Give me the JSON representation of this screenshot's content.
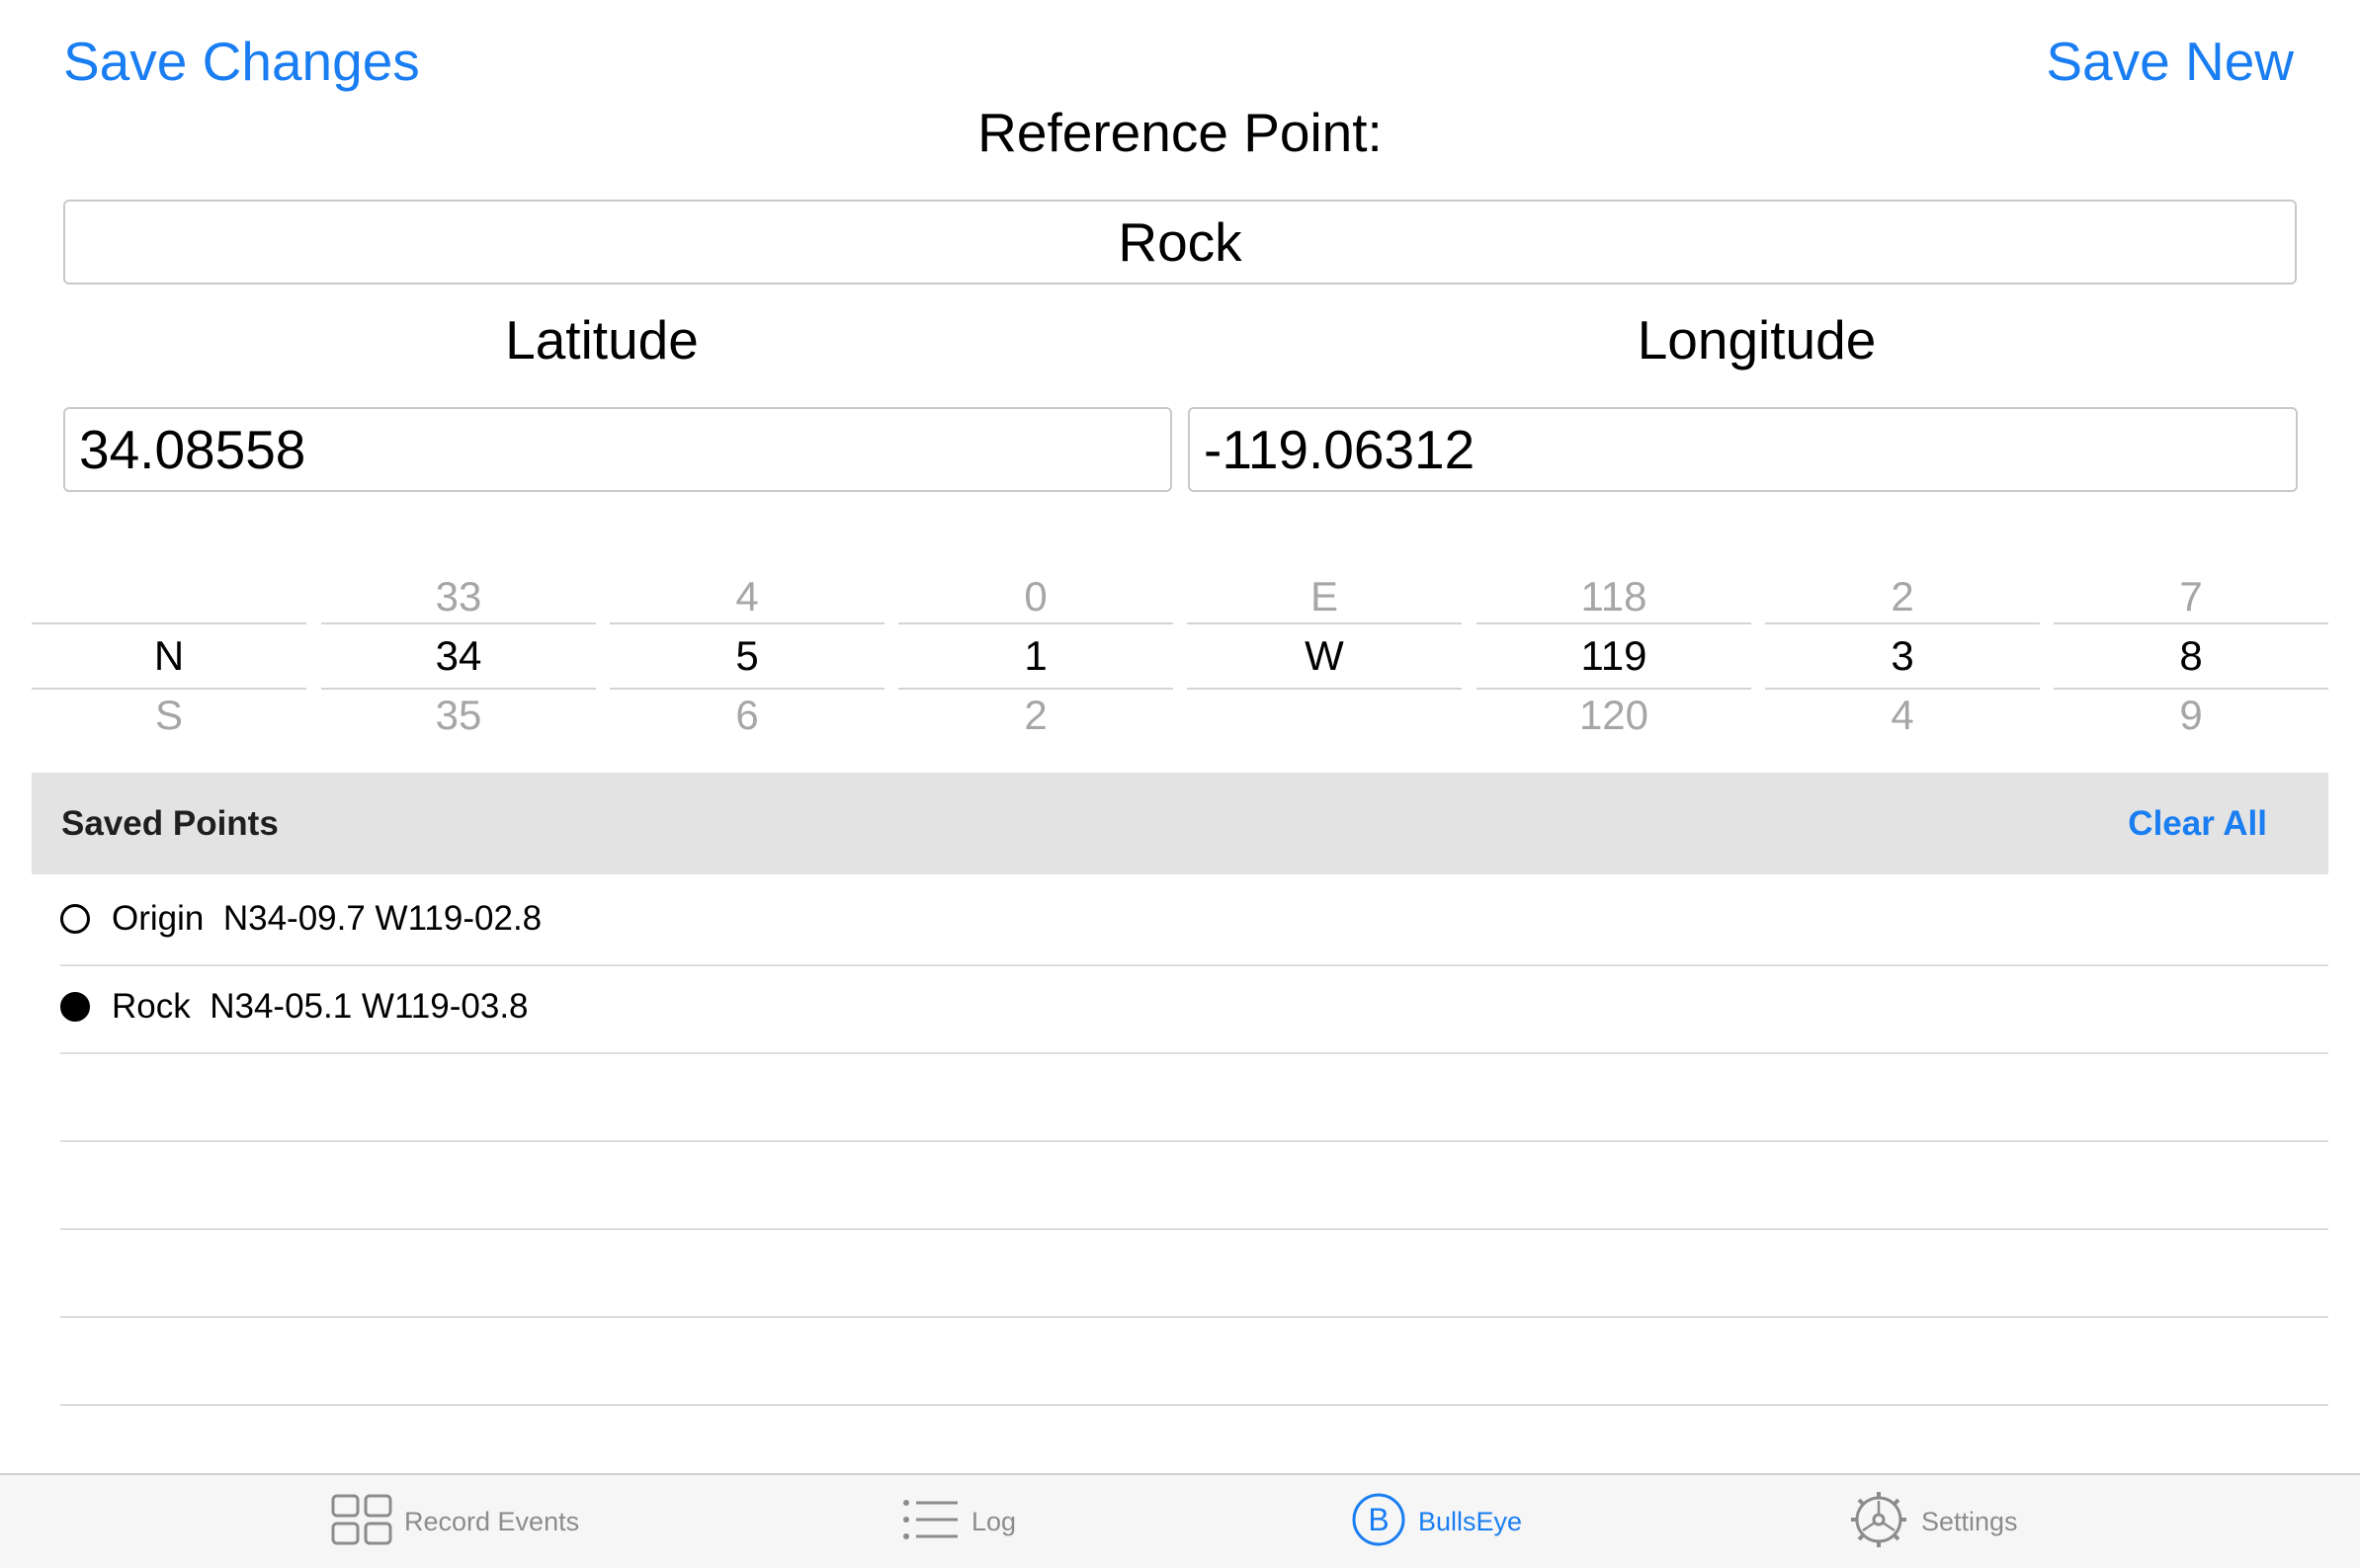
{
  "header": {
    "save_changes": "Save Changes",
    "save_new": "Save New",
    "title": "Reference Point:"
  },
  "reference": {
    "name": "Rock",
    "latitude_label": "Latitude",
    "longitude_label": "Longitude",
    "latitude": "34.08558",
    "longitude": "-119.06312"
  },
  "picker": {
    "columns": [
      {
        "above": "",
        "selected": "N",
        "below": "S"
      },
      {
        "above": "33",
        "selected": "34",
        "below": "35"
      },
      {
        "above": "4",
        "selected": "5",
        "below": "6"
      },
      {
        "above": "0",
        "selected": "1",
        "below": "2"
      },
      {
        "above": "E",
        "selected": "W",
        "below": ""
      },
      {
        "above": "118",
        "selected": "119",
        "below": "120"
      },
      {
        "above": "2",
        "selected": "3",
        "below": "4"
      },
      {
        "above": "7",
        "selected": "8",
        "below": "9"
      }
    ]
  },
  "saved_points": {
    "title": "Saved Points",
    "clear_all": "Clear All",
    "items": [
      {
        "name": "Origin",
        "coords": "N34-09.7 W119-02.8",
        "selected": false
      },
      {
        "name": "Rock",
        "coords": "N34-05.1 W119-03.8",
        "selected": true
      }
    ]
  },
  "tabbar": {
    "tabs": [
      {
        "label": "Record Events",
        "icon": "grid-icon",
        "active": false
      },
      {
        "label": "Log",
        "icon": "list-icon",
        "active": false
      },
      {
        "label": "BullsEye",
        "icon": "bullseye-b-icon",
        "active": true
      },
      {
        "label": "Settings",
        "icon": "gear-icon",
        "active": false
      }
    ]
  },
  "colors": {
    "accent": "#1a7ef2",
    "header_bg": "#e3e3e3",
    "tabbar_bg": "#f6f6f6",
    "inactive": "#8c8c8c"
  }
}
